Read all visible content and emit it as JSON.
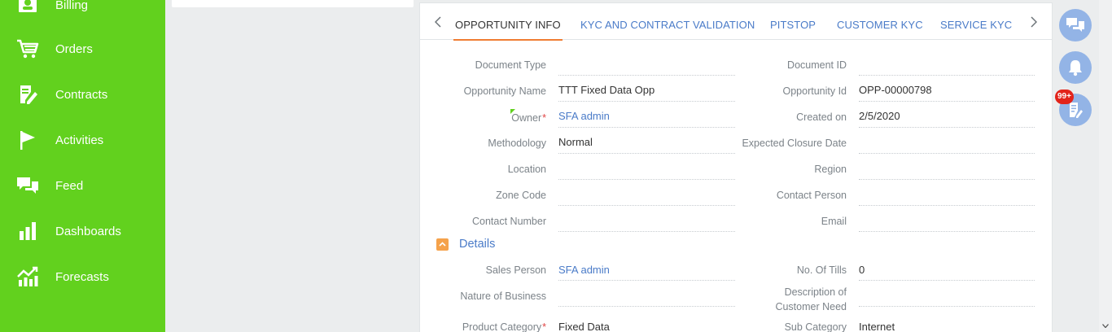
{
  "sidebar": {
    "items": [
      {
        "label": "Billing",
        "icon": "billing-icon"
      },
      {
        "label": "Orders",
        "icon": "cart-icon"
      },
      {
        "label": "Contracts",
        "icon": "contract-edit-icon"
      },
      {
        "label": "Activities",
        "icon": "flag-icon"
      },
      {
        "label": "Feed",
        "icon": "chat-bubbles-icon"
      },
      {
        "label": "Dashboards",
        "icon": "bar-chart-icon"
      },
      {
        "label": "Forecasts",
        "icon": "trend-chart-icon"
      }
    ]
  },
  "tabs": {
    "items": [
      {
        "label": "OPPORTUNITY INFO",
        "active": true
      },
      {
        "label": "KYC AND CONTRACT VALIDATION",
        "active": false
      },
      {
        "label": "PITSTOP",
        "active": false
      },
      {
        "label": "CUSTOMER KYC",
        "active": false
      },
      {
        "label": "SERVICE KYC",
        "active": false
      }
    ]
  },
  "fields": {
    "document_type": {
      "label": "Document Type",
      "value": ""
    },
    "document_id": {
      "label": "Document ID",
      "value": ""
    },
    "opportunity_name": {
      "label": "Opportunity Name",
      "value": "TTT Fixed Data Opp"
    },
    "opportunity_id": {
      "label": "Opportunity Id",
      "value": "OPP-00000798"
    },
    "owner": {
      "label": "Owner",
      "required": "*",
      "value": "SFA admin"
    },
    "created_on": {
      "label": "Created on",
      "value": "2/5/2020"
    },
    "methodology": {
      "label": "Methodology",
      "value": "Normal"
    },
    "expected_closure_date": {
      "label": "Expected Closure Date",
      "value": ""
    },
    "location": {
      "label": "Location",
      "value": ""
    },
    "region": {
      "label": "Region",
      "value": ""
    },
    "zone_code": {
      "label": "Zone Code",
      "value": ""
    },
    "contact_person": {
      "label": "Contact Person",
      "value": ""
    },
    "contact_number": {
      "label": "Contact Number",
      "value": ""
    },
    "email": {
      "label": "Email",
      "value": ""
    }
  },
  "details": {
    "title": "Details",
    "sales_person": {
      "label": "Sales Person",
      "value": "SFA admin"
    },
    "no_of_tills": {
      "label": "No. Of Tills",
      "value": "0"
    },
    "nature_of_business": {
      "label": "Nature of Business",
      "value": ""
    },
    "description_line1": "Description of",
    "description_line2": "Customer Need",
    "description_value": "",
    "product_category": {
      "label": "Product Category",
      "required": "*",
      "value": "Fixed Data"
    },
    "sub_category": {
      "label": "Sub Category",
      "value": "Internet"
    }
  },
  "right_panel": {
    "badge": "99+",
    "buttons": [
      "chat-icon",
      "bell-icon",
      "notes-icon"
    ]
  },
  "colors": {
    "sidebar": "#62d11e",
    "link": "#4a7bc8",
    "active_tab_underline": "#f07d33",
    "side_button": "#93b4e6",
    "badge": "#e2231a"
  }
}
